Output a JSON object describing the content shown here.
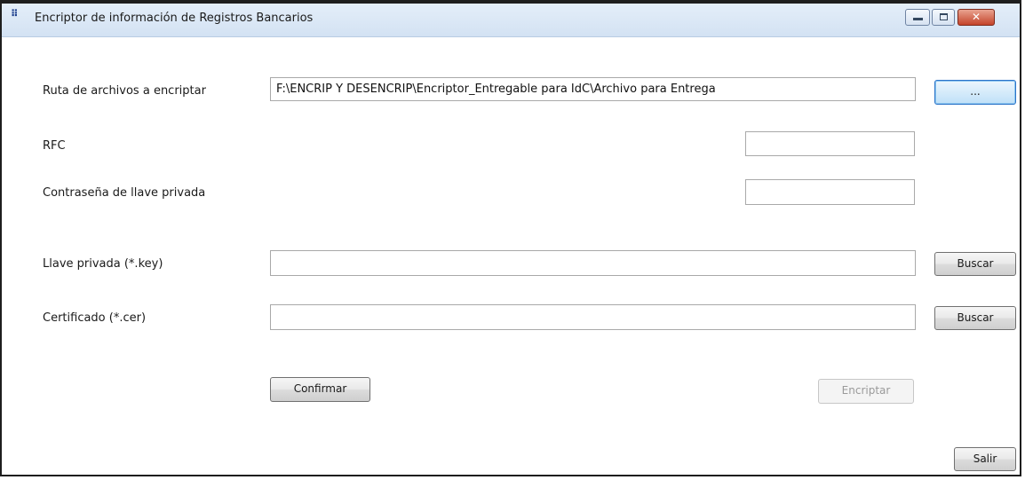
{
  "window": {
    "title": "Encriptor de información de Registros Bancarios",
    "icon": "app-icon",
    "controls": {
      "minimize": "minimize-icon",
      "maximize": "maximize-icon",
      "close": "✕"
    }
  },
  "form": {
    "ruta": {
      "label": "Ruta de archivos a encriptar",
      "value": "F:\\ENCRIP Y DESENCRIP\\Encriptor_Entregable para IdC\\Archivo para Entrega",
      "browse_label": "..."
    },
    "rfc": {
      "label": "RFC",
      "value": ""
    },
    "password": {
      "label": "Contraseña de llave privada",
      "value": ""
    },
    "llave": {
      "label": "Llave privada (*.key)",
      "value": "",
      "button_label": "Buscar"
    },
    "certificado": {
      "label": "Certificado (*.cer)",
      "value": "",
      "button_label": "Buscar"
    }
  },
  "actions": {
    "confirmar": "Confirmar",
    "encriptar": "Encriptar",
    "salir": "Salir"
  }
}
